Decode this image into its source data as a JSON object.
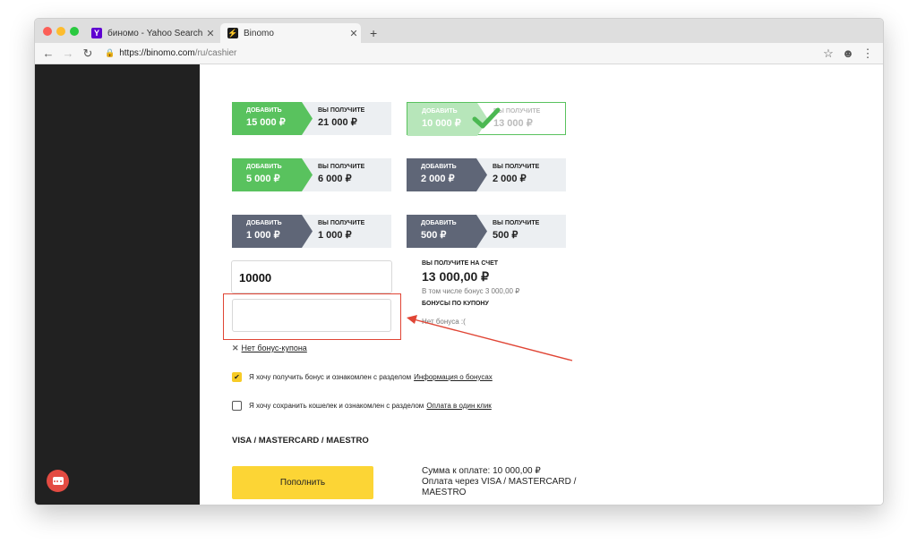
{
  "browser": {
    "tabs": [
      {
        "title": "биномо - Yahoo Search Results",
        "favicon": "Y"
      },
      {
        "title": "Binomo",
        "favicon": "⚡"
      }
    ],
    "close_glyph": "✕",
    "new_tab_glyph": "+",
    "url_host": "https://binomo.com",
    "url_path": "/ru/cashier"
  },
  "packages": [
    {
      "add_label": "ДОБАВИТЬ",
      "add_amount": "15 000 ₽",
      "get_label": "ВЫ ПОЛУЧИТЕ",
      "get_amount": "21 000 ₽",
      "style": "green",
      "selected": false
    },
    {
      "add_label": "ДОБАВИТЬ",
      "add_amount": "10 000 ₽",
      "get_label": "ВЫ ПОЛУЧИТЕ",
      "get_amount": "13 000 ₽",
      "style": "green",
      "selected": true
    },
    {
      "add_label": "ДОБАВИТЬ",
      "add_amount": "5 000 ₽",
      "get_label": "ВЫ ПОЛУЧИТЕ",
      "get_amount": "6 000 ₽",
      "style": "green",
      "selected": false
    },
    {
      "add_label": "ДОБАВИТЬ",
      "add_amount": "2 000 ₽",
      "get_label": "ВЫ ПОЛУЧИТЕ",
      "get_amount": "2 000 ₽",
      "style": "grey",
      "selected": false
    },
    {
      "add_label": "ДОБАВИТЬ",
      "add_amount": "1 000 ₽",
      "get_label": "ВЫ ПОЛУЧИТЕ",
      "get_amount": "1 000 ₽",
      "style": "grey",
      "selected": false
    },
    {
      "add_label": "ДОБАВИТЬ",
      "add_amount": "500 ₽",
      "get_label": "ВЫ ПОЛУЧИТЕ",
      "get_amount": "500 ₽",
      "style": "grey",
      "selected": false
    }
  ],
  "amount_input": {
    "value": "10000"
  },
  "coupon_input": {
    "value": "",
    "placeholder": ""
  },
  "no_coupon": {
    "icon": "✕",
    "label": "Нет бонус-купона"
  },
  "summary": {
    "receive_label": "ВЫ ПОЛУЧИТЕ НА СЧЕТ",
    "receive_amount": "13 000,00 ₽",
    "bonus_note": "В том числе бонус 3 000,00 ₽",
    "coupon_label": "БОНУСЫ ПО КУПОНУ",
    "coupon_value": "Нет бонуса :("
  },
  "checkbox_bonus": {
    "checked": true,
    "text": "Я хочу получить бонус и ознакомлен с разделом",
    "link": "Информация о бонусах"
  },
  "checkbox_wallet": {
    "checked": false,
    "text": "Я хочу сохранить кошелек и ознакомлен с разделом",
    "link": "Оплата в один клик"
  },
  "payment_method": "VISA / MASTERCARD / MAESTRO",
  "pay_button": "Пополнить",
  "pay_summary": {
    "line1": "Сумма к оплате: 10 000,00 ₽",
    "line2": "Оплата через VISA / MASTERCARD /",
    "line3": "MAESTRO"
  },
  "colors": {
    "accent_yellow": "#fcd535",
    "green": "#59c25e",
    "grey": "#5f6677",
    "annotation_red": "#e04535"
  }
}
